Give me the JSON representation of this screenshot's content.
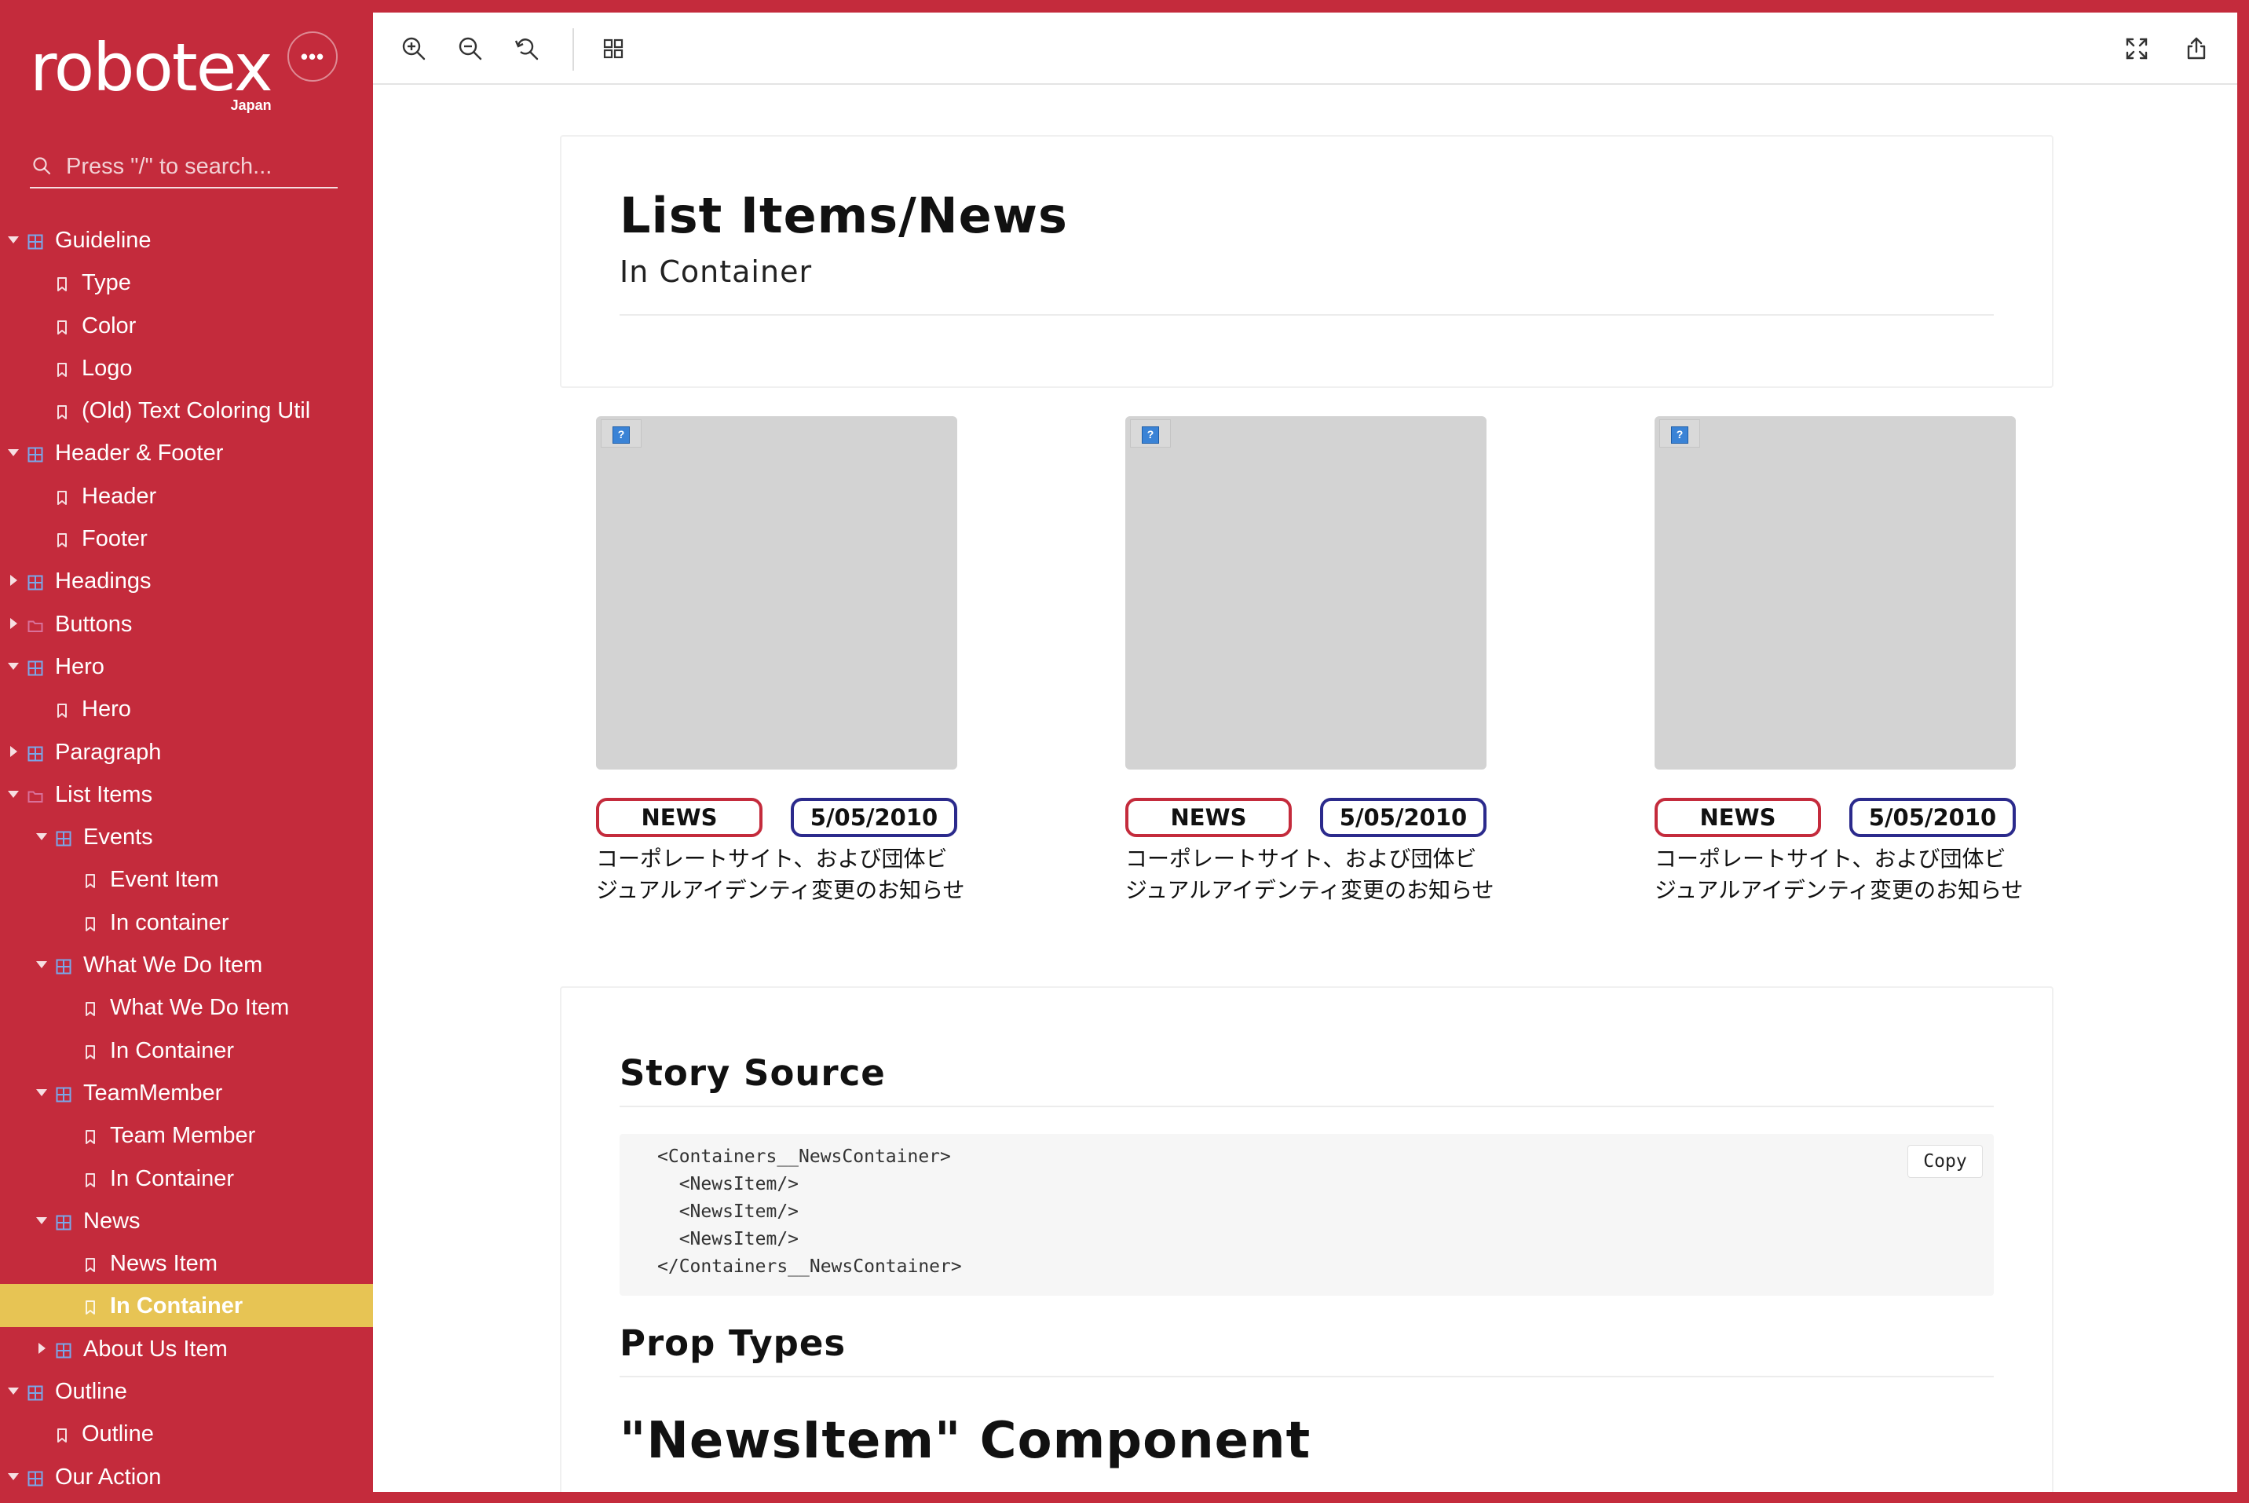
{
  "brand": {
    "name": "robotex",
    "sub": "Japan",
    "menu_glyph": "•••"
  },
  "search": {
    "placeholder": "Press \"/\" to search..."
  },
  "colors": {
    "sidebar": "#c42b3c",
    "active": "#e7c454",
    "category_border": "#c42b3c",
    "date_border": "#2b2a8c"
  },
  "tree": [
    {
      "label": "Guideline",
      "depth": 0,
      "kind": "component",
      "toggle": "expanded"
    },
    {
      "label": "Type",
      "depth": 1,
      "kind": "story"
    },
    {
      "label": "Color",
      "depth": 1,
      "kind": "story"
    },
    {
      "label": "Logo",
      "depth": 1,
      "kind": "story"
    },
    {
      "label": "(Old) Text Coloring Util",
      "depth": 1,
      "kind": "story"
    },
    {
      "label": "Header & Footer",
      "depth": 0,
      "kind": "component",
      "toggle": "expanded"
    },
    {
      "label": "Header",
      "depth": 1,
      "kind": "story"
    },
    {
      "label": "Footer",
      "depth": 1,
      "kind": "story"
    },
    {
      "label": "Headings",
      "depth": 0,
      "kind": "component",
      "toggle": "collapsed"
    },
    {
      "label": "Buttons",
      "depth": 0,
      "kind": "folder",
      "toggle": "collapsed"
    },
    {
      "label": "Hero",
      "depth": 0,
      "kind": "component",
      "toggle": "expanded"
    },
    {
      "label": "Hero",
      "depth": 1,
      "kind": "story"
    },
    {
      "label": "Paragraph",
      "depth": 0,
      "kind": "component",
      "toggle": "collapsed"
    },
    {
      "label": "List Items",
      "depth": 0,
      "kind": "folder",
      "toggle": "expanded"
    },
    {
      "label": "Events",
      "depth": 1,
      "kind": "component",
      "toggle": "expanded"
    },
    {
      "label": "Event Item",
      "depth": 2,
      "kind": "story"
    },
    {
      "label": "In container",
      "depth": 2,
      "kind": "story"
    },
    {
      "label": "What We Do Item",
      "depth": 1,
      "kind": "component",
      "toggle": "expanded"
    },
    {
      "label": "What We Do Item",
      "depth": 2,
      "kind": "story"
    },
    {
      "label": "In Container",
      "depth": 2,
      "kind": "story"
    },
    {
      "label": "TeamMember",
      "depth": 1,
      "kind": "component",
      "toggle": "expanded"
    },
    {
      "label": "Team Member",
      "depth": 2,
      "kind": "story"
    },
    {
      "label": "In Container",
      "depth": 2,
      "kind": "story"
    },
    {
      "label": "News",
      "depth": 1,
      "kind": "component",
      "toggle": "expanded"
    },
    {
      "label": "News Item",
      "depth": 2,
      "kind": "story"
    },
    {
      "label": "In Container",
      "depth": 2,
      "kind": "story",
      "active": true
    },
    {
      "label": "About Us Item",
      "depth": 1,
      "kind": "component",
      "toggle": "collapsed"
    },
    {
      "label": "Outline",
      "depth": 0,
      "kind": "component",
      "toggle": "expanded"
    },
    {
      "label": "Outline",
      "depth": 1,
      "kind": "story"
    },
    {
      "label": "Our Action",
      "depth": 0,
      "kind": "component",
      "toggle": "expanded"
    }
  ],
  "toolbar": {
    "left": [
      "zoom-in-icon",
      "zoom-out-icon",
      "reset-zoom-icon",
      "grid-icon"
    ],
    "right": [
      "fullscreen-icon",
      "share-icon"
    ]
  },
  "page": {
    "title": "List Items/News",
    "subtitle": "In Container"
  },
  "news_items": [
    {
      "category": "NEWS",
      "date": "5/05/2010",
      "text": "コーポレートサイト、および団体ビジュアルアイデンティ変更のお知らせ"
    },
    {
      "category": "NEWS",
      "date": "5/05/2010",
      "text": "コーポレートサイト、および団体ビジュアルアイデンティ変更のお知らせ"
    },
    {
      "category": "NEWS",
      "date": "5/05/2010",
      "text": "コーポレートサイト、および団体ビジュアルアイデンティ変更のお知らせ"
    }
  ],
  "docs": {
    "story_source_heading": "Story Source",
    "code_lines": [
      "<Containers__NewsContainer>",
      "  <NewsItem/>",
      "  <NewsItem/>",
      "  <NewsItem/>",
      "</Containers__NewsContainer>"
    ],
    "copy_label": "Copy",
    "prop_types_heading": "Prop Types",
    "component_heading": "\"NewsItem\" Component"
  }
}
